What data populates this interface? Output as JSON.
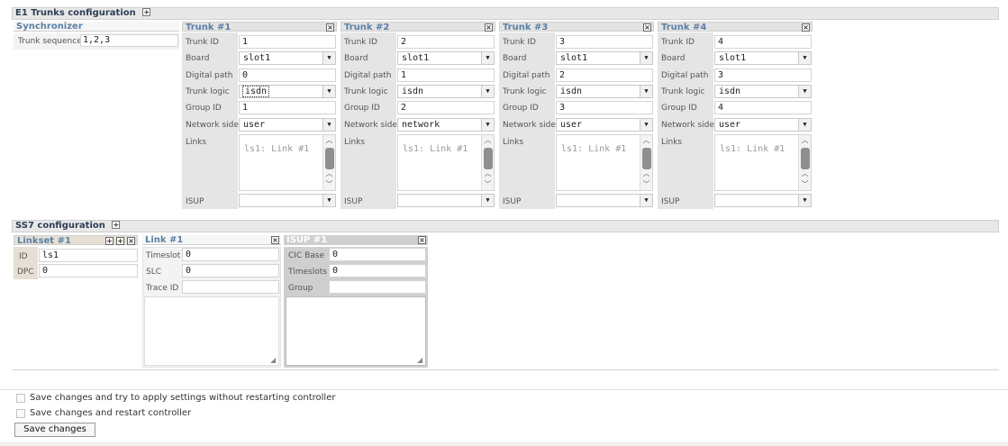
{
  "e1": {
    "title": "E1 Trunks configuration",
    "synchronizer": {
      "title": "Synchronizer",
      "seq_label": "Trunk sequence",
      "seq_value": "1,2,3"
    },
    "labels": {
      "trunk_id": "Trunk ID",
      "board": "Board",
      "digital_path": "Digital path",
      "trunk_logic": "Trunk logic",
      "group_id": "Group ID",
      "network_side": "Network side",
      "links": "Links",
      "isup": "ISUP"
    },
    "trunks": [
      {
        "title": "Trunk #1",
        "trunk_id": "1",
        "board": "slot1",
        "digital_path": "0",
        "trunk_logic": "isdn",
        "group_id": "1",
        "network_side": "user",
        "links": "ls1: Link #1",
        "isup": ""
      },
      {
        "title": "Trunk #2",
        "trunk_id": "2",
        "board": "slot1",
        "digital_path": "1",
        "trunk_logic": "isdn",
        "group_id": "2",
        "network_side": "network",
        "links": "ls1: Link #1",
        "isup": ""
      },
      {
        "title": "Trunk #3",
        "trunk_id": "3",
        "board": "slot1",
        "digital_path": "2",
        "trunk_logic": "isdn",
        "group_id": "3",
        "network_side": "user",
        "links": "ls1: Link #1",
        "isup": ""
      },
      {
        "title": "Trunk #4",
        "trunk_id": "4",
        "board": "slot1",
        "digital_path": "3",
        "trunk_logic": "isdn",
        "group_id": "4",
        "network_side": "user",
        "links": "ls1: Link #1",
        "isup": ""
      }
    ]
  },
  "ss7": {
    "title": "SS7 configuration",
    "linkset": {
      "title": "Linkset #1",
      "id_label": "ID",
      "id_value": "ls1",
      "dpc_label": "DPC",
      "dpc_value": "0"
    },
    "link": {
      "title": "Link #1",
      "timeslot_label": "Timeslot",
      "timeslot_value": "0",
      "slc_label": "SLC",
      "slc_value": "0",
      "trace_label": "Trace ID",
      "trace_value": ""
    },
    "isup": {
      "title": "ISUP #1",
      "cic_label": "CIC Base",
      "cic_value": "0",
      "timeslots_label": "Timeslots",
      "timeslots_value": "0",
      "group_label": "Group",
      "group_value": ""
    }
  },
  "footer": {
    "apply_label": "Save changes and try to apply settings without restarting controller",
    "restart_label": "Save changes and restart controller",
    "save_button": "Save changes"
  },
  "icons": {
    "expand": "plus-icon",
    "close": "close-icon",
    "dropdown": "chevron-down-icon"
  }
}
